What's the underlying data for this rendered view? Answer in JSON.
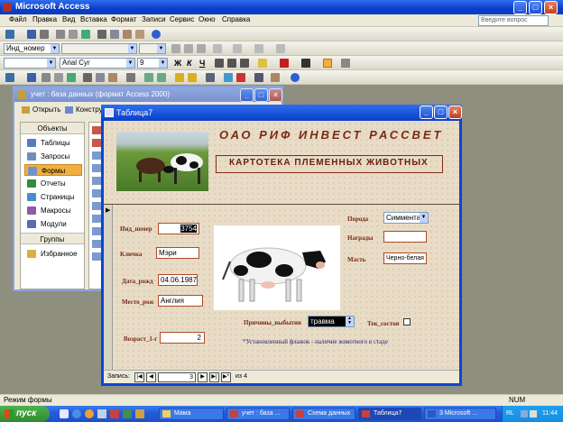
{
  "app": {
    "title": "Microsoft Access"
  },
  "menu": [
    "Файл",
    "Правка",
    "Вид",
    "Вставка",
    "Формат",
    "Записи",
    "Сервис",
    "Окно",
    "Справка"
  ],
  "help_placeholder": "Введите вопрос",
  "toolbar2": {
    "field_combo": "Инд_номер"
  },
  "toolbar3": {
    "font": "Arial Cyr",
    "size": "9"
  },
  "db_window": {
    "title": "учет : база данных (формат Access 2000)",
    "open_label": "Открыть",
    "design_label": "Конструк",
    "objects_header": "Объекты",
    "objects": [
      "Таблицы",
      "Запросы",
      "Формы",
      "Отчеты",
      "Страницы",
      "Макросы",
      "Модули"
    ],
    "groups_header": "Группы",
    "groups": [
      "Избранное"
    ]
  },
  "form_window": {
    "title": "Таблица7",
    "header1": "ОАО РИФ ИНВЕСТ РАССВЕТ",
    "header2": "КАРТОТЕКА ПЛЕМЕННЫХ ЖИВОТНЫХ",
    "fields": {
      "id_label": "Инд_номер",
      "id_value": "3754",
      "name_label": "Кличка",
      "name_value": "Мэри",
      "dob_label": "Дата_рожд",
      "dob_value": "04.06.1987",
      "place_label": "Место_рож",
      "place_value": "Англия",
      "age_label": "Возраст_1-г",
      "age_value": "2",
      "breed_label": "Порода",
      "breed_value": "Симмента",
      "awards_label": "Награды",
      "awards_value": "",
      "color_label": "Масть",
      "color_value": "Черно-белая",
      "reason_label": "Причины_выбытия",
      "reason_value": "травма",
      "current_label": "Тек_состоя"
    },
    "note": "*Установленный флажок - наличие животного в стаде",
    "nav": {
      "label": "Запись:",
      "current": "3",
      "of_text": "из 4"
    }
  },
  "status": {
    "mode": "Режим формы",
    "num": "NUM"
  },
  "taskbar": {
    "start": "пуск",
    "tasks": [
      "Мама",
      "учет : база ...",
      "Схема данных",
      "Таблица7",
      "3 Microsoft ..."
    ],
    "lang": "RL",
    "time": "11:44"
  }
}
